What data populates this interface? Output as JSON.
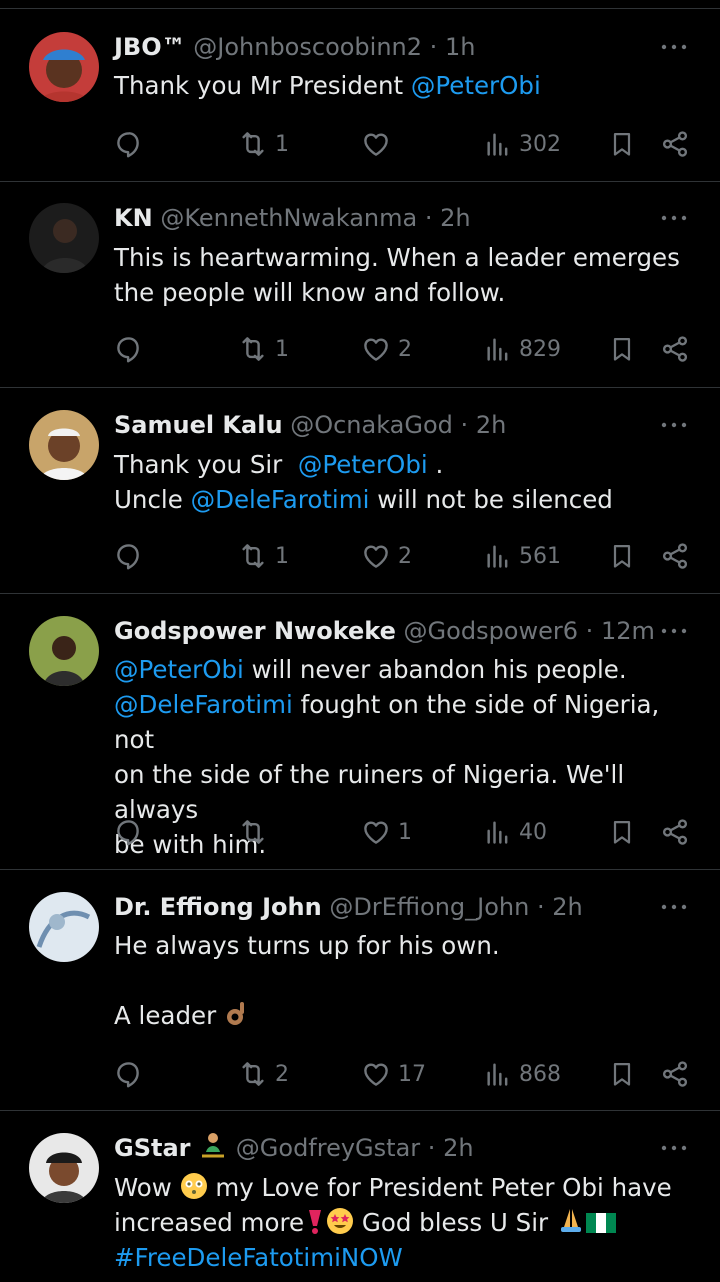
{
  "tweets": [
    {
      "name": "JBO™",
      "handle": "@Johnboscoobinn2",
      "time": "1h",
      "text_a": "Thank you Mr President ",
      "mention_a": "@PeterObi",
      "replies": "",
      "retweets": "1",
      "likes": "",
      "views": "302"
    },
    {
      "name": "KN",
      "handle": "@KennethNwakanma",
      "time": "2h",
      "line1": "This is heartwarming. When a leader emerges",
      "line2": "the people will know and follow.",
      "replies": "",
      "retweets": "1",
      "likes": "2",
      "views": "829"
    },
    {
      "name": "Samuel Kalu",
      "handle": "@OcnakaGod",
      "time": "2h",
      "l1_a": "Thank you Sir  ",
      "l1_mention": "@PeterObi",
      "l1_b": " .",
      "l2_a": "Uncle ",
      "l2_mention": "@DeleFarotimi",
      "l2_b": " will not be silenced",
      "replies": "",
      "retweets": "1",
      "likes": "2",
      "views": "561"
    },
    {
      "name": "Godspower Nwokeke",
      "handle": "@Godspower6",
      "time": "12m",
      "l1_mention": "@PeterObi",
      "l1_b": " will never abandon his people.",
      "l2_mention": "@DeleFarotimi",
      "l2_b": " fought on the side of Nigeria, not",
      "l3": "on the side of the ruiners of Nigeria. We'll always",
      "l4": "be with him.",
      "replies": "",
      "retweets": "",
      "likes": "1",
      "views": "40"
    },
    {
      "name": "Dr. Effiong John",
      "handle": "@DrEffiong_John",
      "time": "2h",
      "l1": "He always turns up for his own.",
      "l2": "A leader ",
      "replies": "",
      "retweets": "2",
      "likes": "17",
      "views": "868"
    },
    {
      "name": "GStar",
      "handle": "@GodfreyGstar",
      "time": "2h",
      "l1_a": "Wow ",
      "l1_b": " my Love for President Peter Obi have",
      "l2_a": "increased more",
      "l2_b": " God bless U Sir ",
      "hashtag": "#FreeDeleFatotimiNOW"
    }
  ],
  "dot": "·",
  "colors": {
    "background": "#000000",
    "text": "#e7e9ea",
    "muted": "#71767b",
    "link": "#1d9bf0",
    "divider": "#2f3336"
  },
  "icons": [
    "reply-icon",
    "retweet-icon",
    "like-icon",
    "views-icon",
    "bookmark-icon",
    "share-icon",
    "more-icon"
  ]
}
